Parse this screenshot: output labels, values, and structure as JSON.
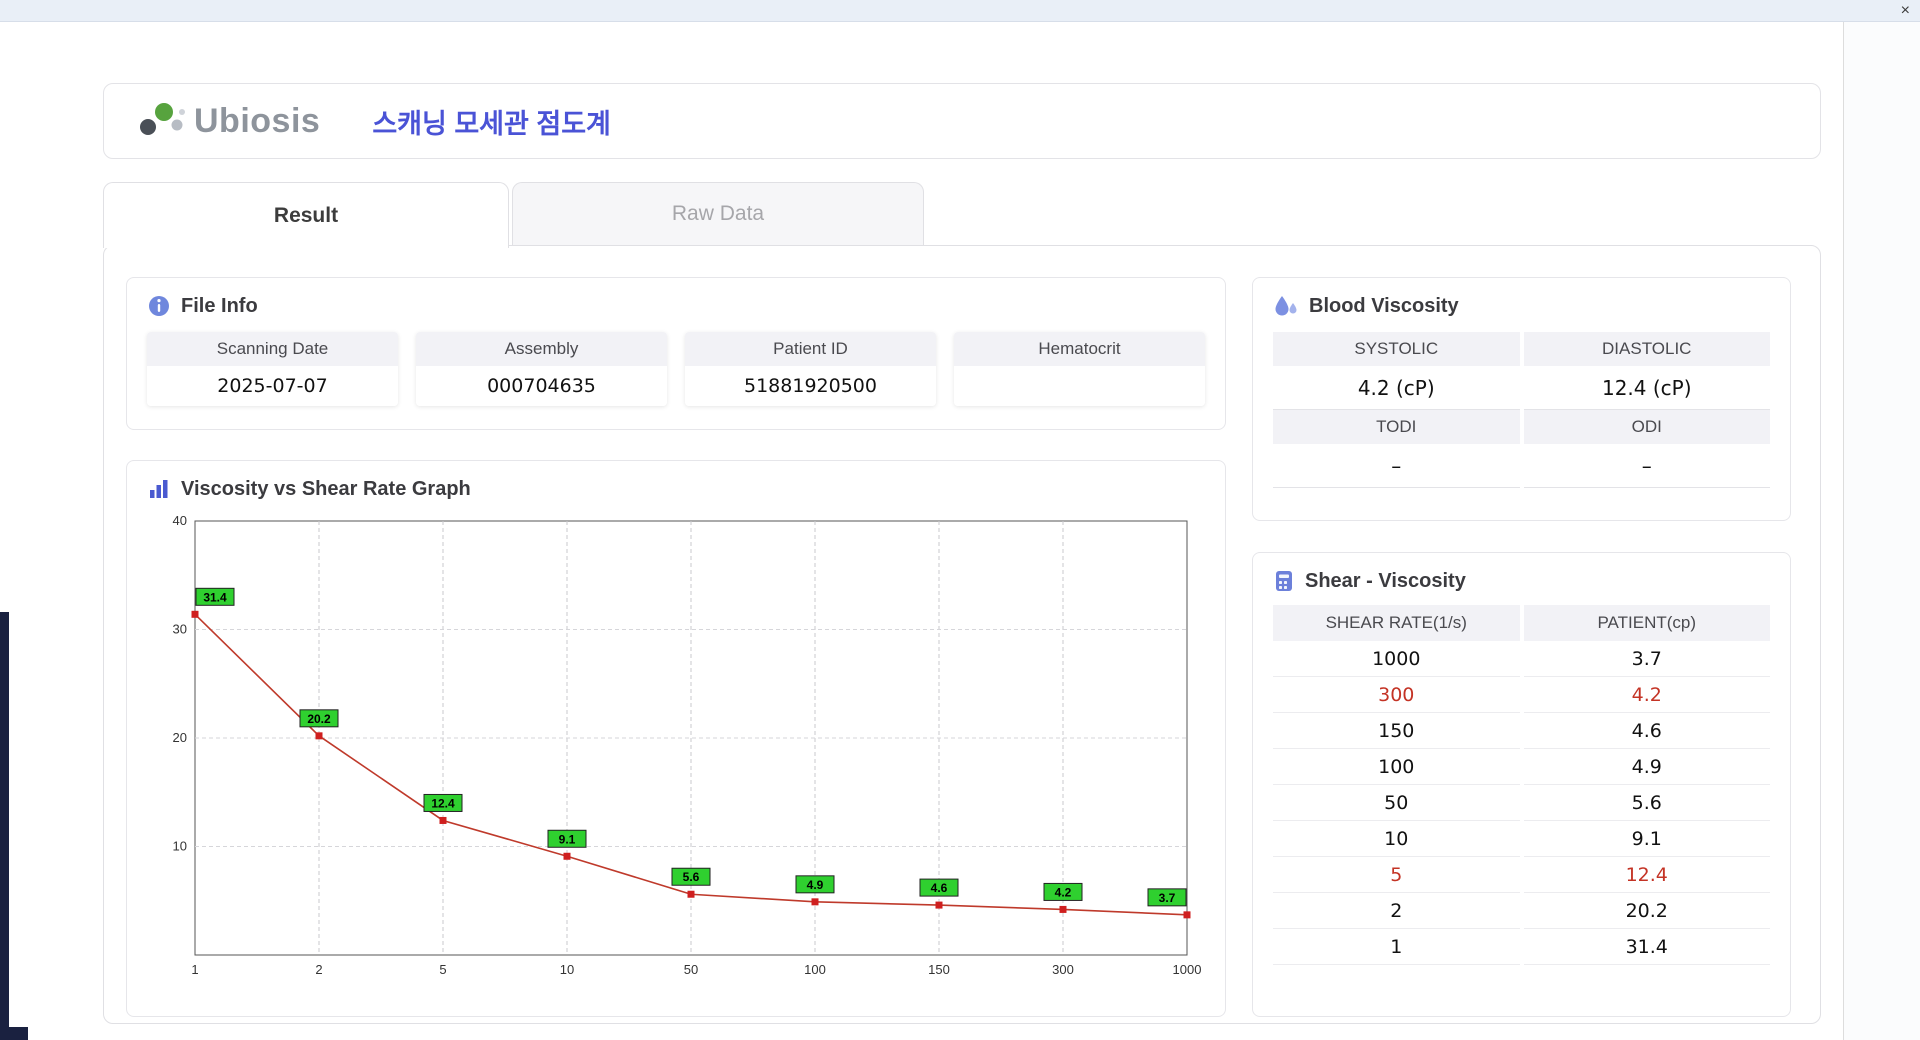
{
  "window": {
    "close": "×"
  },
  "header": {
    "logo": "Ubiosis",
    "title": "스캐닝 모세관 점도계"
  },
  "tabs": {
    "result": "Result",
    "raw_data": "Raw Data"
  },
  "file_info": {
    "title": "File Info",
    "fields": [
      {
        "label": "Scanning Date",
        "value": "2025-07-07"
      },
      {
        "label": "Assembly",
        "value": "000704635"
      },
      {
        "label": "Patient ID",
        "value": "51881920500"
      },
      {
        "label": "Hematocrit",
        "value": ""
      }
    ]
  },
  "graph_section": {
    "title": "Viscosity vs Shear Rate Graph"
  },
  "chart_data": {
    "type": "line",
    "title": "Viscosity vs Shear Rate Graph",
    "x": [
      1,
      2,
      5,
      10,
      50,
      100,
      150,
      300,
      1000
    ],
    "x_scale": "categorical-log-like",
    "values": [
      31.4,
      20.2,
      12.4,
      9.1,
      5.6,
      4.9,
      4.6,
      4.2,
      3.7
    ],
    "point_labels": [
      "31.4",
      "20.2",
      "12.4",
      "9.1",
      "5.6",
      "4.9",
      "4.6",
      "4.2",
      "3.7"
    ],
    "xlabel": "",
    "ylabel": "",
    "ylim": [
      0,
      40
    ],
    "yticks": [
      10,
      20,
      30,
      40
    ],
    "grid": true,
    "line_color": "#bf3a2b",
    "marker_color": "#cf1f1f",
    "label_bg": "#2fd02f"
  },
  "blood_viscosity": {
    "title": "Blood Viscosity",
    "metrics": [
      {
        "label": "SYSTOLIC",
        "value": "4.2 (cP)"
      },
      {
        "label": "DIASTOLIC",
        "value": "12.4 (cP)"
      },
      {
        "label": "TODI",
        "value": "–"
      },
      {
        "label": "ODI",
        "value": "–"
      }
    ]
  },
  "shear_viscosity": {
    "title": "Shear - Viscosity",
    "columns": [
      "SHEAR RATE(1/s)",
      "PATIENT(cp)"
    ],
    "rows": [
      {
        "rate": "1000",
        "patient": "3.7",
        "highlight": false
      },
      {
        "rate": "300",
        "patient": "4.2",
        "highlight": true
      },
      {
        "rate": "150",
        "patient": "4.6",
        "highlight": false
      },
      {
        "rate": "100",
        "patient": "4.9",
        "highlight": false
      },
      {
        "rate": "50",
        "patient": "5.6",
        "highlight": false
      },
      {
        "rate": "10",
        "patient": "9.1",
        "highlight": false
      },
      {
        "rate": "5",
        "patient": "12.4",
        "highlight": true
      },
      {
        "rate": "2",
        "patient": "20.2",
        "highlight": false
      },
      {
        "rate": "1",
        "patient": "31.4",
        "highlight": false
      }
    ]
  },
  "colors": {
    "accent_blue": "#4a53d6",
    "highlight_red": "#c43325",
    "label_green": "#2fd02f",
    "chart_line": "#bf3a2b"
  }
}
